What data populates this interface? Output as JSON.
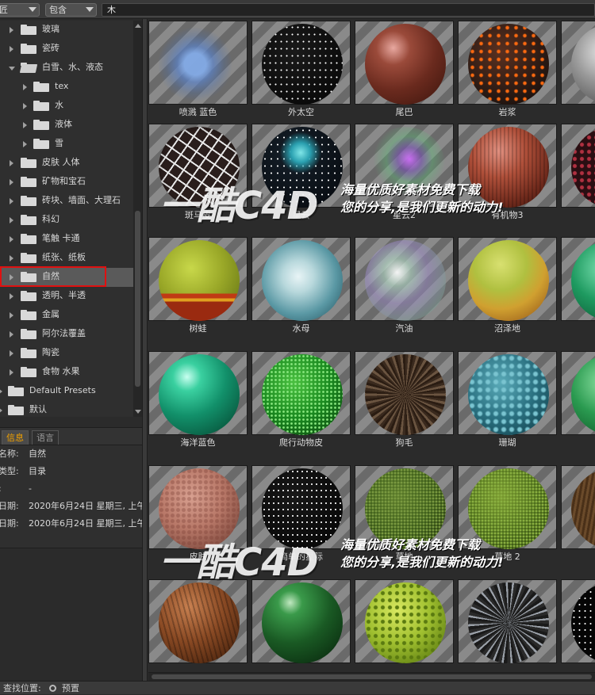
{
  "topbar": {
    "scope_value": "匠",
    "filter_value": "包含",
    "search_value": "木"
  },
  "tree": {
    "items": [
      {
        "label": "玻璃"
      },
      {
        "label": "瓷砖"
      },
      {
        "label": "白雪、水、液态"
      },
      {
        "label": "tex"
      },
      {
        "label": "水"
      },
      {
        "label": "液体"
      },
      {
        "label": "雪"
      },
      {
        "label": "皮肤 人体"
      },
      {
        "label": "矿物和宝石"
      },
      {
        "label": "砖块、墙面、大理石"
      },
      {
        "label": "科幻"
      },
      {
        "label": "笔触 卡通"
      },
      {
        "label": "纸张、纸板"
      },
      {
        "label": "自然"
      },
      {
        "label": "透明、半透"
      },
      {
        "label": "金属"
      },
      {
        "label": "阿尔法覆盖"
      },
      {
        "label": "陶瓷"
      },
      {
        "label": "食物 水果"
      },
      {
        "label": "Default Presets"
      },
      {
        "label": "默认"
      }
    ],
    "selected": "自然"
  },
  "tabs": {
    "info": "信息",
    "lang": "语言"
  },
  "info": {
    "rows": [
      {
        "key": "名称:",
        "value": "自然"
      },
      {
        "key": "类型:",
        "value": "目录"
      },
      {
        "key": ":",
        "value": "-"
      },
      {
        "key": "日期:",
        "value": "2020年6月24日 星期三, 上午"
      },
      {
        "key": "日期:",
        "value": "2020年6月24日 星期三, 上午"
      }
    ]
  },
  "status": {
    "label": "查找位置:",
    "value": "预置"
  },
  "grid": {
    "items": [
      {
        "label": "喷溅 蓝色"
      },
      {
        "label": "外太空"
      },
      {
        "label": "尾巴"
      },
      {
        "label": "岩浆"
      },
      {
        "label": ""
      },
      {
        "label": "斑马皮"
      },
      {
        "label": "星云"
      },
      {
        "label": "星云2"
      },
      {
        "label": "有机物3"
      },
      {
        "label": ""
      },
      {
        "label": "树蛙"
      },
      {
        "label": "水母"
      },
      {
        "label": "汽油"
      },
      {
        "label": "沼泽地"
      },
      {
        "label": ""
      },
      {
        "label": "海洋蓝色"
      },
      {
        "label": "爬行动物皮"
      },
      {
        "label": "狗毛"
      },
      {
        "label": "珊瑚"
      },
      {
        "label": ""
      },
      {
        "label": "皮肤"
      },
      {
        "label": "简单的星际"
      },
      {
        "label": "草地"
      },
      {
        "label": "草地 2"
      },
      {
        "label": ""
      },
      {
        "label": ""
      },
      {
        "label": ""
      },
      {
        "label": ""
      },
      {
        "label": ""
      },
      {
        "label": ""
      }
    ]
  },
  "watermark": {
    "brand": "一酷C4D",
    "line1": "海量优质好素材免费下载",
    "line2": "您的分享,是我们更新的动力!"
  },
  "colors": {
    "selection_outline": "#e01010",
    "active_tab_text": "#f0a000"
  }
}
